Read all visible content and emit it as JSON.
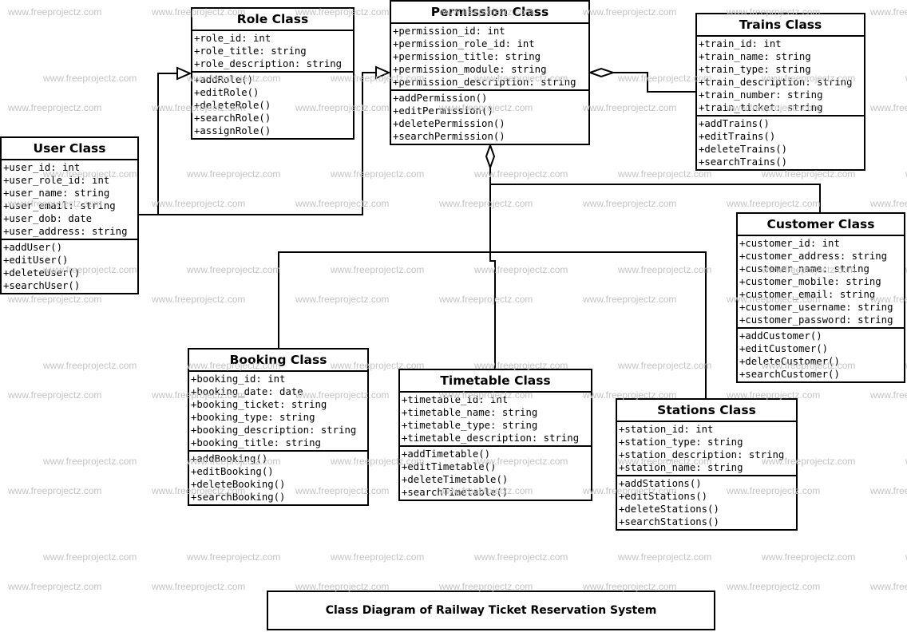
{
  "diagram_title": "Class Diagram of Railway Ticket Reservation System",
  "watermark": "www.freeprojectz.com",
  "classes": {
    "role": {
      "name": "Role Class",
      "attributes": [
        "+role_id: int",
        "+role_title: string",
        "+role_description: string"
      ],
      "methods": [
        "+addRole()",
        "+editRole()",
        "+deleteRole()",
        "+searchRole()",
        "+assignRole()"
      ]
    },
    "permission": {
      "name": "Permission Class",
      "attributes": [
        "+permission_id: int",
        "+permission_role_id: int",
        "+permission_title: string",
        "+permission_module: string",
        "+permission_description: string"
      ],
      "methods": [
        "+addPermission()",
        "+editPermission()",
        "+deletePermission()",
        "+searchPermission()"
      ]
    },
    "trains": {
      "name": "Trains Class",
      "attributes": [
        "+train_id: int",
        "+train_name: string",
        "+train_type: string",
        "+train_description: string",
        "+train_number: string",
        "+train_ticket: string"
      ],
      "methods": [
        "+addTrains()",
        "+editTrains()",
        "+deleteTrains()",
        "+searchTrains()"
      ]
    },
    "user": {
      "name": "User Class",
      "attributes": [
        "+user_id: int",
        "+user_role_id: int",
        "+user_name: string",
        "+user_email: string",
        "+user_dob: date",
        "+user_address: string"
      ],
      "methods": [
        "+addUser()",
        "+editUser()",
        "+deleteUser()",
        "+searchUser()"
      ]
    },
    "customer": {
      "name": "Customer Class",
      "attributes": [
        "+customer_id: int",
        "+customer_address: string",
        "+customer_name: string",
        "+customer_mobile: string",
        "+customer_email: string",
        "+customer_username: string",
        "+customer_password: string"
      ],
      "methods": [
        "+addCustomer()",
        "+editCustomer()",
        "+deleteCustomer()",
        "+searchCustomer()"
      ]
    },
    "booking": {
      "name": "Booking Class",
      "attributes": [
        "+booking_id: int",
        "+booking_date: date",
        "+booking_ticket: string",
        "+booking_type: string",
        "+booking_description: string",
        "+booking_title: string"
      ],
      "methods": [
        "+addBooking()",
        "+editBooking()",
        "+deleteBooking()",
        "+searchBooking()"
      ]
    },
    "timetable": {
      "name": "Timetable Class",
      "attributes": [
        "+timetable_id: int",
        "+timetable_name: string",
        "+timetable_type: string",
        "+timetable_description: string"
      ],
      "methods": [
        "+addTimetable()",
        "+editTimetable()",
        "+deleteTimetable()",
        "+searchTimetable()"
      ]
    },
    "stations": {
      "name": "Stations Class",
      "attributes": [
        "+station_id: int",
        "+station_type: string",
        "+station_description: string",
        "+station_name: string"
      ],
      "methods": [
        "+addStations()",
        "+editStations()",
        "+deleteStations()",
        "+searchStations()"
      ]
    }
  },
  "relationships": [
    {
      "from": "user",
      "to": "role",
      "type": "generalization"
    },
    {
      "from": "user",
      "to": "permission",
      "type": "generalization"
    },
    {
      "from": "trains",
      "to": "permission",
      "type": "aggregation"
    },
    {
      "from": "customer",
      "to": "permission",
      "type": "aggregation"
    },
    {
      "from": "booking",
      "to": "permission",
      "type": "aggregation"
    },
    {
      "from": "timetable",
      "to": "permission",
      "type": "aggregation"
    },
    {
      "from": "stations",
      "to": "permission",
      "type": "aggregation"
    }
  ]
}
